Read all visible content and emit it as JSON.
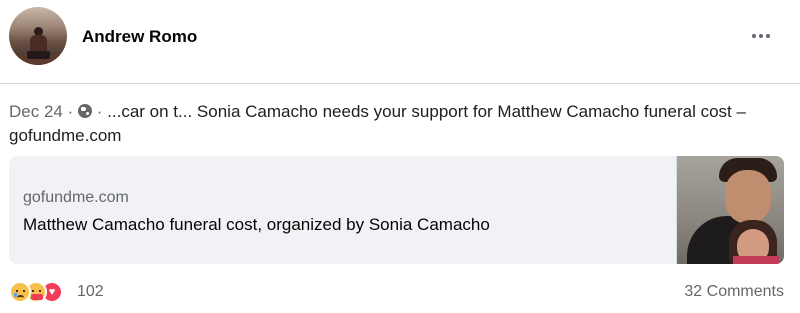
{
  "post": {
    "author": {
      "name": "Andrew Romo",
      "avatar": "profile-photo"
    },
    "menu_icon": "more-options-icon",
    "date": "Dec 24",
    "separator": "·",
    "audience_icon": "globe-icon",
    "text": "...car on t... Sonia Camacho needs your support for Matthew Camacho funeral cost – gofundme.com"
  },
  "link_card": {
    "domain": "gofundme.com",
    "title": "Matthew Camacho funeral cost, organized by Sonia Camacho",
    "thumbnail": "link-thumbnail-photo"
  },
  "footer": {
    "reaction_icons": [
      "sad-reaction-icon",
      "care-reaction-icon",
      "love-reaction-icon"
    ],
    "reaction_count": "102",
    "comments": "32 Comments"
  },
  "colors": {
    "card_background": "#f0f2f5",
    "secondary_text": "#65676b",
    "love_red": "#f33e58",
    "reaction_yellow": "#f7c04a"
  }
}
